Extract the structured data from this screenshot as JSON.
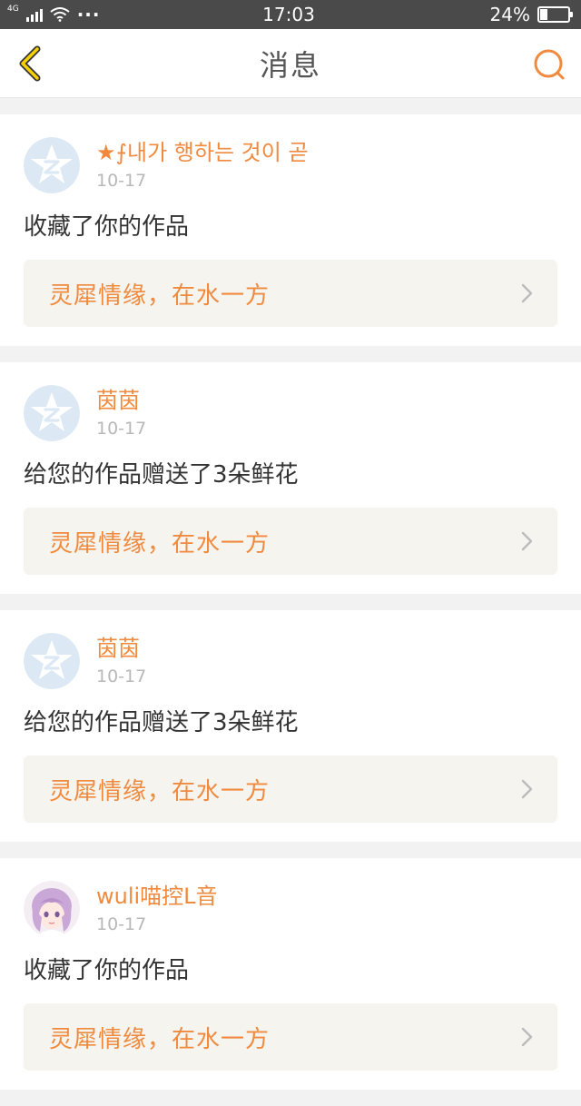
{
  "status": {
    "network": "4G",
    "dots": "···",
    "time": "17:03",
    "battery_text": "24%",
    "battery_level": 0.24
  },
  "header": {
    "title": "消息"
  },
  "colors": {
    "accent": "#f08a3e",
    "back_icon": "#f5d100"
  },
  "messages": [
    {
      "name": "★⨍내가 행하는 것이 곧",
      "date": "10-17",
      "action": "收藏了你的作品",
      "work_title": "灵犀情缘，在水一方",
      "avatar": "default-avatar-icon"
    },
    {
      "name": "茵茵",
      "date": "10-17",
      "action": "给您的作品赠送了3朵鲜花",
      "work_title": "灵犀情缘，在水一方",
      "avatar": "default-avatar-icon"
    },
    {
      "name": "茵茵",
      "date": "10-17",
      "action": "给您的作品赠送了3朵鲜花",
      "work_title": "灵犀情缘，在水一方",
      "avatar": "default-avatar-icon"
    },
    {
      "name": "wuli喵控L音",
      "date": "10-17",
      "action": "收藏了你的作品",
      "work_title": "灵犀情缘，在水一方",
      "avatar": "anime-avatar-icon"
    }
  ]
}
